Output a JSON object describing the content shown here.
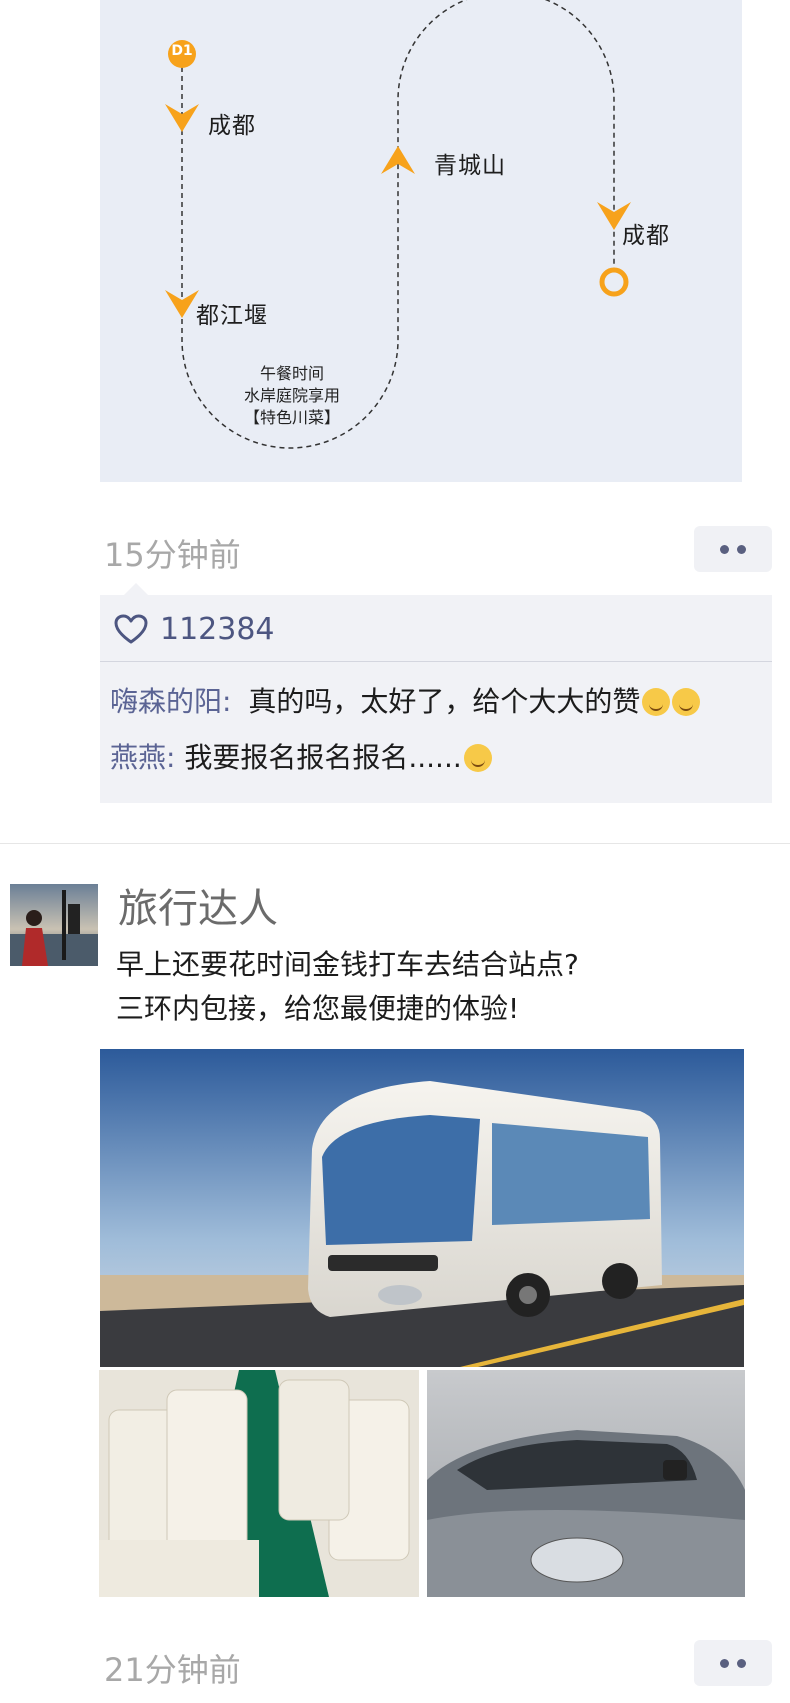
{
  "route": {
    "badge": "D1",
    "stops": [
      "成都",
      "都江堰",
      "青城山",
      "成都"
    ],
    "lunch": [
      "午餐时间",
      "水岸庭院享用",
      "【特色川菜】"
    ],
    "accent_color": "#f7a21b",
    "background_color": "#e9edf5"
  },
  "post1": {
    "time": "15分钟前",
    "like_icon": "heart-outline-icon",
    "like_count": "112384",
    "comments": [
      {
        "user": "嗨森的阳:",
        "text": "真的吗，太好了，给个大大的赞",
        "emojis": [
          "kissing-heart-emoji",
          "kissing-heart-emoji"
        ]
      },
      {
        "user": "燕燕:",
        "text": "我要报名报名报名......",
        "emojis": [
          "grinning-emoji"
        ]
      }
    ]
  },
  "post2": {
    "author": "旅行达人",
    "lines": [
      "早上还要花时间金钱打车去结合站点?",
      "三环内包接，给您最便捷的体验!"
    ],
    "images": [
      "white-coach-bus-on-road",
      "bus-interior-seats",
      "silver-car-front"
    ],
    "time": "21分钟前"
  }
}
